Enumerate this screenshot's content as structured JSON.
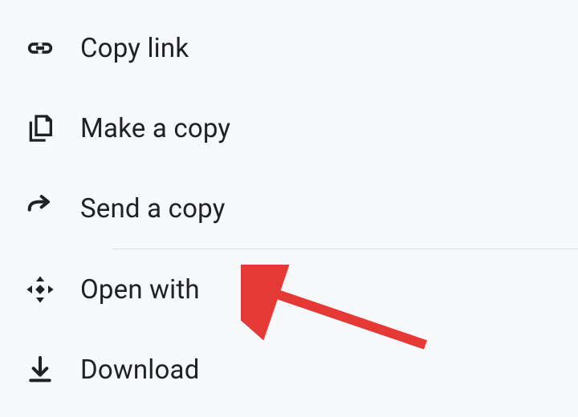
{
  "menu": {
    "items": [
      {
        "label": "Copy link",
        "icon": "link-icon"
      },
      {
        "label": "Make a copy",
        "icon": "copy-icon"
      },
      {
        "label": "Send a copy",
        "icon": "send-icon"
      },
      {
        "label": "Open with",
        "icon": "open-with-icon"
      },
      {
        "label": "Download",
        "icon": "download-icon"
      }
    ]
  },
  "annotation": {
    "target": "open-with",
    "color": "#e53935"
  }
}
